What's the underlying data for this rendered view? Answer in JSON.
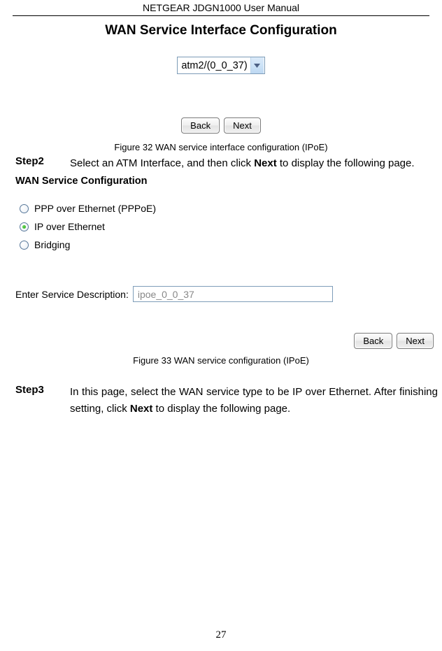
{
  "header": {
    "title": "NETGEAR JDGN1000 User Manual"
  },
  "figure32": {
    "title": "WAN Service Interface Configuration",
    "select_value": "atm2/(0_0_37)",
    "back_label": "Back",
    "next_label": "Next",
    "caption": "Figure 32 WAN service interface configuration (IPoE)"
  },
  "step2": {
    "label": "Step2",
    "text_before": "Select an ATM Interface, and then click ",
    "text_bold": "Next",
    "text_after": " to display the following page."
  },
  "figure33": {
    "title": "WAN Service Configuration",
    "options": {
      "pppoe": "PPP over Ethernet (PPPoE)",
      "ipoe": "IP over Ethernet",
      "bridging": "Bridging"
    },
    "desc_label": "Enter Service Description:",
    "desc_value": "ipoe_0_0_37",
    "back_label": "Back",
    "next_label": "Next",
    "caption": "Figure 33 WAN service configuration (IPoE)"
  },
  "step3": {
    "label": "Step3",
    "text_before": "In this page, select the WAN service type to be IP over Ethernet. After finishing setting, click ",
    "text_bold": "Next",
    "text_after": " to display the following page."
  },
  "page_number": "27"
}
